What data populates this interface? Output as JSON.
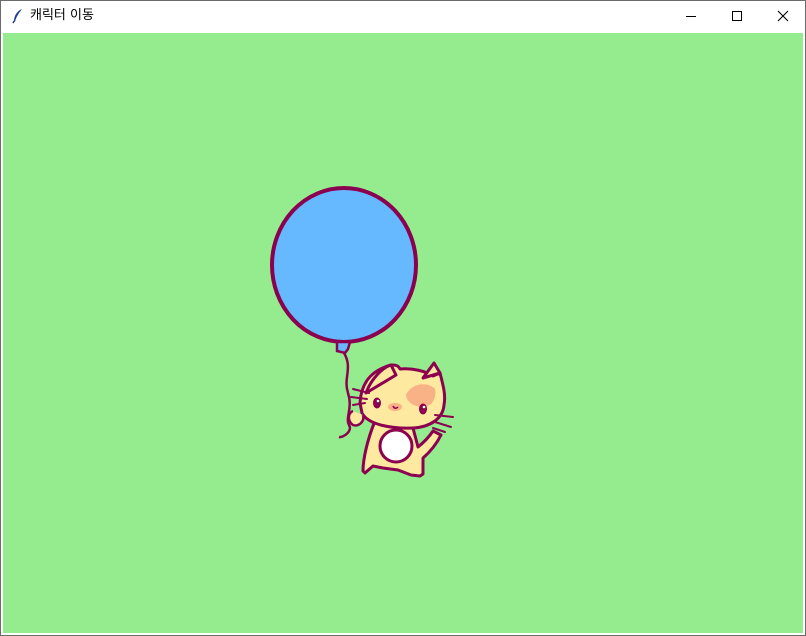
{
  "window": {
    "title": "캐릭터 이동",
    "icon": "feather-icon",
    "controls": [
      "minimize-icon",
      "maximize-icon",
      "close-icon"
    ]
  },
  "canvas": {
    "background": "#94ec8f",
    "items": [
      {
        "name": "balloon",
        "fill": "#66b8ff",
        "outline": "#8c0050"
      },
      {
        "name": "cat-character",
        "body": "#fde9a0",
        "patch": "#f9b286",
        "outline": "#8c0050"
      }
    ]
  }
}
